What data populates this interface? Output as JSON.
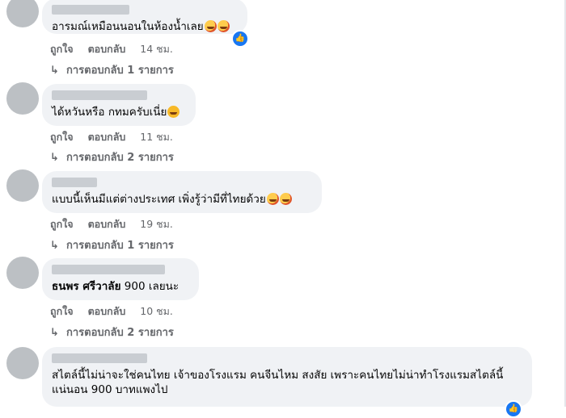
{
  "comments": [
    {
      "text": "อารมณ์เหมือนนอนในห้องน้ำเลย",
      "like": "ถูกใจ",
      "reply": "ตอบกลับ",
      "time": "14 ชม.",
      "replies": "การตอบกลับ 1 รายการ",
      "reaction_icon": "like-reaction-icon"
    },
    {
      "text": "ได้หวันหรือ กทมครับเนี่ย",
      "like": "ถูกใจ",
      "reply": "ตอบกลับ",
      "time": "11 ชม.",
      "replies": "การตอบกลับ 2 รายการ"
    },
    {
      "text": "แบบนี้เห็นมีแต่ต่างประเทศ เพิ่งรู้ว่ามีที่ไทยด้วย",
      "like": "ถูกใจ",
      "reply": "ตอบกลับ",
      "time": "19 ชม.",
      "replies": "การตอบกลับ 1 รายการ"
    },
    {
      "tagged_name": "ธนพร ศรีวาลัย",
      "text": "900 เลยนะ",
      "like": "ถูกใจ",
      "reply": "ตอบกลับ",
      "time": "10 ชม.",
      "replies": "การตอบกลับ 2 รายการ"
    },
    {
      "text": "สไตล์นี้ไม่น่าจะใช่คนไทย เจ้าของโรงแรม คนจีนไหม สงสัย เพราะคนไทยไม่น่าทำโรงแรมสไตล์นี้แน่นอน 900 บาทแพงไป"
    }
  ],
  "colors": {
    "bubble": "#f0f2f5",
    "meta": "#65676b",
    "accent": "#1877f2"
  }
}
